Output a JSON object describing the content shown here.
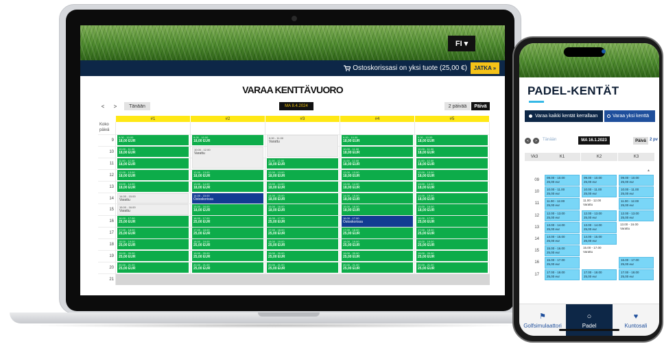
{
  "laptop": {
    "language": "FI",
    "cart": {
      "icon": "cart-icon",
      "text": "Ostoskorissasi on yksi tuote (25,00 €)",
      "continue_label": "JATKA »"
    },
    "title": "VARAA KENTTÄVUORO",
    "nav": {
      "prev": "<",
      "next": ">",
      "today": "Tänään",
      "date": "MA 8.4.2024",
      "two_days": "2 päivää",
      "one_day": "Päivä"
    },
    "courts": [
      "#1",
      "#2",
      "#3",
      "#4",
      "#5"
    ],
    "all_day_label": "Koko päivä",
    "hours": [
      "9",
      "10",
      "11",
      "12",
      "13",
      "14",
      "15",
      "16",
      "17",
      "18",
      "19",
      "20",
      "21"
    ],
    "slots": [
      [
        [
          "9.00 - 10.00",
          "18,00 EUR",
          "free"
        ],
        [
          "10.00 - 11.00",
          "18,00 EUR",
          "free"
        ],
        [
          "11.00 - 12.00",
          "18,00 EUR",
          "free"
        ],
        [
          "12.00 - 13.00",
          "18,00 EUR",
          "free"
        ],
        [
          "13.00 - 14.00",
          "18,00 EUR",
          "free"
        ],
        [
          "14.00 - 15.00",
          "Varattu",
          "res"
        ],
        [
          "15.00 - 16.00",
          "Varattu",
          "res"
        ],
        [
          "16.00 - 17.00",
          "25,00 EUR",
          "free"
        ],
        [
          "17.00 - 18.00",
          "25,00 EUR",
          "free"
        ],
        [
          "18.00 - 19.00",
          "25,00 EUR",
          "free"
        ],
        [
          "19.00 - 20.00",
          "25,00 EUR",
          "free"
        ],
        [
          "20.00 - 21.00",
          "25,00 EUR",
          "free"
        ]
      ],
      [
        [
          "9.00 - 10.00",
          "18,00 EUR",
          "free"
        ],
        [
          "10.00 - 12.00",
          "Varattu",
          "res"
        ],
        null,
        [
          "12.00 - 13.00",
          "18,00 EUR",
          "free"
        ],
        [
          "13.00 - 14.00",
          "18,00 EUR",
          "free"
        ],
        [
          "14.00 - 15.00",
          "Ostoskorissa",
          "cart"
        ],
        [
          "15.00 - 16.00",
          "18,00 EUR",
          "free"
        ],
        [
          "16.00 - 17.00",
          "25,00 EUR",
          "free"
        ],
        [
          "17.00 - 18.00",
          "25,00 EUR",
          "free"
        ],
        [
          "18.00 - 19.00",
          "25,00 EUR",
          "free"
        ],
        [
          "19.00 - 20.00",
          "25,00 EUR",
          "free"
        ],
        [
          "20.00 - 21.00",
          "25,00 EUR",
          "free"
        ]
      ],
      [
        [
          "9.00 - 11.00",
          "Varattu",
          "res"
        ],
        null,
        [
          "11.00 - 12.00",
          "18,00 EUR",
          "free"
        ],
        [
          "12.00 - 13.00",
          "18,00 EUR",
          "free"
        ],
        [
          "13.00 - 14.00",
          "18,00 EUR",
          "free"
        ],
        [
          "14.00 - 15.00",
          "18,00 EUR",
          "free"
        ],
        [
          "15.00 - 16.00",
          "18,00 EUR",
          "free"
        ],
        [
          "16.00 - 17.00",
          "25,00 EUR",
          "free"
        ],
        [
          "17.00 - 18.00",
          "25,00 EUR",
          "free"
        ],
        [
          "18.00 - 19.00",
          "25,00 EUR",
          "free"
        ],
        [
          "19.00 - 20.00",
          "25,00 EUR",
          "free"
        ],
        [
          "20.00 - 21.00",
          "25,00 EUR",
          "free"
        ]
      ],
      [
        [
          "9.00 - 10.00",
          "18,00 EUR",
          "free"
        ],
        [
          "10.00 - 11.00",
          "18,00 EUR",
          "free"
        ],
        [
          "11.00 - 12.00",
          "18,00 EUR",
          "free"
        ],
        [
          "12.00 - 13.00",
          "18,00 EUR",
          "free"
        ],
        [
          "13.00 - 14.00",
          "18,00 EUR",
          "free"
        ],
        [
          "14.00 - 15.00",
          "18,00 EUR",
          "free"
        ],
        [
          "15.00 - 16.00",
          "18,00 EUR",
          "free"
        ],
        [
          "16.00 - 17.00",
          "Ostoskorissa",
          "cart"
        ],
        [
          "17.00 - 18.00",
          "25,00 EUR",
          "free"
        ],
        [
          "18.00 - 19.00",
          "25,00 EUR",
          "free"
        ],
        [
          "19.00 - 20.00",
          "25,00 EUR",
          "free"
        ],
        [
          "20.00 - 21.00",
          "25,00 EUR",
          "free"
        ]
      ],
      [
        [
          "9.00 - 10.00",
          "18,00 EUR",
          "free"
        ],
        [
          "10.00 - 11.00",
          "18,00 EUR",
          "free"
        ],
        [
          "11.00 - 12.00",
          "18,00 EUR",
          "free"
        ],
        [
          "12.00 - 13.00",
          "18,00 EUR",
          "free"
        ],
        [
          "13.00 - 14.00",
          "18,00 EUR",
          "free"
        ],
        [
          "14.00 - 15.00",
          "18,00 EUR",
          "free"
        ],
        [
          "15.00 - 16.00",
          "18,00 EUR",
          "free"
        ],
        [
          "16.00 - 17.00",
          "25,00 EUR",
          "free"
        ],
        [
          "17.00 - 18.00",
          "25,00 EUR",
          "free"
        ],
        [
          "18.00 - 19.00",
          "25,00 EUR",
          "free"
        ],
        [
          "19.00 - 20.00",
          "25,00 EUR",
          "free"
        ],
        [
          "20.00 - 21.00",
          "25,00 EUR",
          "free"
        ]
      ]
    ]
  },
  "phone": {
    "title": "PADEL-KENTÄT",
    "mode_all": "Varaa kaikki kentät kerrallaan",
    "mode_one": "Varaa yksi kenttä",
    "nav": {
      "prev": "<",
      "next": ">",
      "today": "Tänään",
      "date": "MA 16.1.2023",
      "one_day": "Päivä",
      "two_days": "2 pv"
    },
    "week_label": "Vk3",
    "courts": [
      "K1",
      "K2",
      "K3"
    ],
    "hours": [
      "09",
      "10",
      "11",
      "12",
      "13",
      "14",
      "15",
      "16",
      "17"
    ],
    "slots": [
      [
        [
          "09.00 - 10.00",
          "25,00 eur",
          "free"
        ],
        [
          "10.00 - 11.00",
          "25,00 eur",
          "free"
        ],
        [
          "11.00 - 12.00",
          "25,00 eur",
          "free"
        ],
        [
          "12.00 - 13.00",
          "25,00 eur",
          "free"
        ],
        [
          "13.00 - 14.00",
          "25,00 eur",
          "free"
        ],
        [
          "14.00 - 15.00",
          "25,00 eur",
          "free"
        ],
        [
          "15.00 - 16.00",
          "25,00 eur",
          "free"
        ],
        [
          "15.00 - 17.00",
          "25,00 eur",
          "free"
        ],
        [
          "17.00 - 18.00",
          "25,00 eur",
          "free"
        ]
      ],
      [
        [
          "09.00 - 10.00",
          "25,00 eur",
          "free"
        ],
        [
          "10.00 - 11.00",
          "25,00 eur",
          "free"
        ],
        [
          "11.00 - 12.00",
          "Varattu",
          "res"
        ],
        [
          "12.00 - 13.00",
          "25,00 eur",
          "free"
        ],
        [
          "13.00 - 14.00",
          "25,00 eur",
          "free"
        ],
        [
          "14.00 - 15.00",
          "25,00 eur",
          "free"
        ],
        [
          "15.00 - 17.00",
          "Varattu",
          "res"
        ],
        null,
        [
          "17.00 - 18.00",
          "25,00 eur",
          "free"
        ]
      ],
      [
        [
          "09.00 - 10.00",
          "25,00 eur",
          "free"
        ],
        [
          "10.00 - 11.00",
          "25,00 eur",
          "free"
        ],
        [
          "11.00 - 12.00",
          "25,00 eur",
          "free"
        ],
        [
          "12.00 - 13.00",
          "25,00 eur",
          "free"
        ],
        [
          "13.00 - 16.00",
          "Varattu",
          "res"
        ],
        null,
        null,
        [
          "16.00 - 17.00",
          "25,00 eur",
          "free"
        ],
        [
          "17.00 - 18.00",
          "25,00 eur",
          "free"
        ]
      ]
    ],
    "tabs": [
      {
        "label": "Golfsimulaattori",
        "icon": "flag-icon"
      },
      {
        "label": "Padel",
        "icon": "circle-icon"
      },
      {
        "label": "Kuntosali",
        "icon": "heart-pulse-icon"
      }
    ]
  },
  "colors": {
    "navy": "#0d2747",
    "free": "#0dac4a",
    "in_cart": "#123c92",
    "accent_yellow": "#f5c218",
    "phone_free": "#79d6f7"
  }
}
